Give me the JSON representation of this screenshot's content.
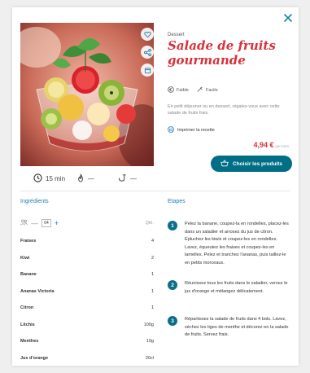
{
  "recipe": {
    "category": "Dessert",
    "title": "Salade de fruits gourmande",
    "cost_label": "Faible",
    "difficulty_label": "Facile",
    "description": "En petit déjeuner ou en dessert, régalez-vous avec cette salade de fruits frais.",
    "print_label": "Imprimer la recette",
    "price": "4,94 €",
    "price_unit": "par pers",
    "cta_label": "Choisir les produits",
    "meta": {
      "time": "15 min",
      "cooking": "—",
      "rest": "—"
    }
  },
  "ingredients": {
    "title": "Ingrédients",
    "servings": "04",
    "minus": "—",
    "plus": "+",
    "qty_header": "Qté.",
    "items": [
      {
        "name": "Fraises",
        "qty": "4"
      },
      {
        "name": "Kiwi",
        "qty": "2"
      },
      {
        "name": "Banane",
        "qty": "1"
      },
      {
        "name": "Ananas Victoria",
        "qty": "1"
      },
      {
        "name": "Citron",
        "qty": "1"
      },
      {
        "name": "Litchis",
        "qty": "100g"
      },
      {
        "name": "Menthes",
        "qty": "10g"
      },
      {
        "name": "Jus d'orange",
        "qty": "20cl"
      }
    ]
  },
  "steps": {
    "title": "Etapes",
    "items": [
      {
        "num": "1",
        "text": "Pelez la banane, coupez-la en rondelles, placez-les dans un saladier et arrosez du jus de citron. Épluchez les kiwis et coupez-les en rondelles. Lavez, équeutez les fraises et coupez-les en lamelles. Pelez et tranchez l'ananas, puis taillez-le en petits morceaux."
      },
      {
        "num": "2",
        "text": "Réunissez tous les fruits dans le saladier, versez le jus d'orange et mélangez délicatement."
      },
      {
        "num": "3",
        "text": "Répartissez la salade de fruits dans 4 bols. Lavez, séchez les tiges de menthe et décorez-en la salade de fruits. Servez frais."
      }
    ]
  },
  "icons": {
    "close": "close-icon",
    "favorite": "heart-icon",
    "share": "share-icon",
    "save": "bookmark-icon",
    "time": "clock-icon",
    "cooking": "flame-icon",
    "rest": "rest-icon",
    "cost": "euro-icon",
    "difficulty": "chef-icon",
    "print": "printer-icon",
    "cart": "basket-icon",
    "servings": "people-icon"
  },
  "colors": {
    "title": "#d9313b",
    "accent": "#006f86",
    "section": "#1e7fb2"
  }
}
